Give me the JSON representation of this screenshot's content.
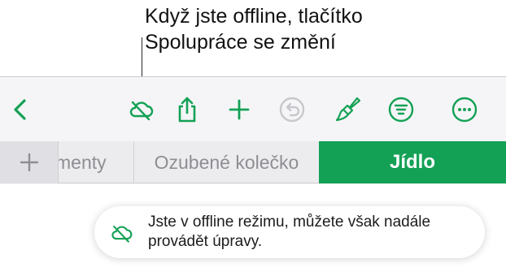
{
  "callout": {
    "line1": "Když jste offline, tlačítko",
    "line2": "Spolupráce se změní"
  },
  "toolbar": {
    "icons": [
      "chevron-left-icon",
      "cloud-offline-icon",
      "share-icon",
      "plus-icon",
      "undo-icon",
      "paintbrush-icon",
      "filter-icon",
      "more-icon"
    ],
    "accent_color": "#13a155",
    "disabled_color": "#c7c7cc"
  },
  "tabs": {
    "partial_label": "menty",
    "gear_label": "Ozubené kolečko",
    "active_label": "Jídlo"
  },
  "banner": {
    "message": "Jste v offline režimu, můžete však nadále provádět úpravy."
  }
}
